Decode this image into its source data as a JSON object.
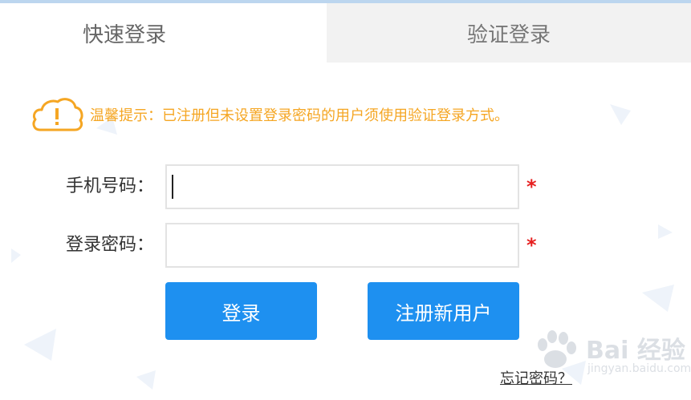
{
  "tabs": {
    "quick_login": "快速登录",
    "verify_login": "验证登录"
  },
  "notice": {
    "icon": "cloud-warning-icon",
    "text": "温馨提示：已注册但未设置登录密码的用户须使用验证登录方式。",
    "color": "#f5a623"
  },
  "form": {
    "phone_label": "手机号码：",
    "phone_value": "",
    "password_label": "登录密码：",
    "password_value": "",
    "required_mark": "*"
  },
  "buttons": {
    "login": "登录",
    "register": "注册新用户"
  },
  "links": {
    "forgot_password": "忘记密码？"
  },
  "watermark": {
    "text": "Bai 经验",
    "sub": "jingyan.baidu.com"
  },
  "colors": {
    "accent": "#1e90f0",
    "warning": "#f5a623",
    "required": "#e62020"
  }
}
